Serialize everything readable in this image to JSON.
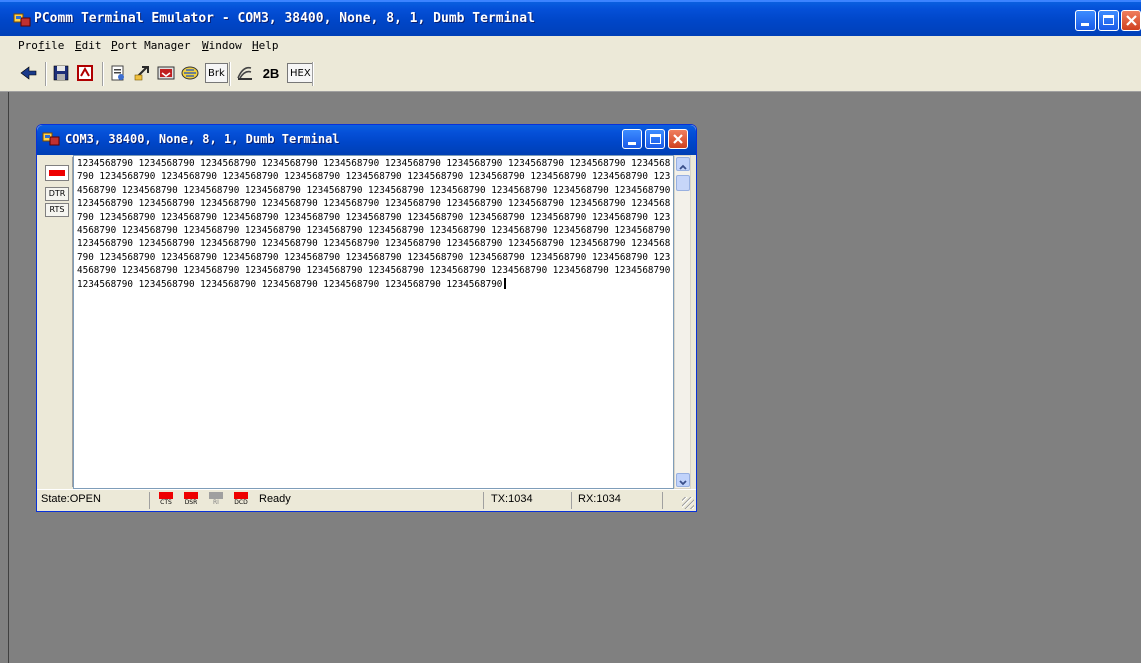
{
  "app": {
    "title": "PComm Terminal Emulator - COM3, 38400, None, 8, 1, Dumb Terminal",
    "colors": {
      "title_bar": "#0046c8",
      "workspace": "#808080",
      "led_on": "#ee0000",
      "led_off": "#a0a0a0"
    }
  },
  "menu": [
    {
      "label": "Profile",
      "key": "f"
    },
    {
      "label": "Edit",
      "key": "E"
    },
    {
      "label": "Port Manager",
      "key": "P"
    },
    {
      "label": "Window",
      "key": "W"
    },
    {
      "label": "Help",
      "key": "H"
    }
  ],
  "toolbar": {
    "brk_label": "Brk",
    "twob_label": "2B",
    "hex_label": "HEX"
  },
  "child": {
    "title": "COM3, 38400, None, 8, 1, Dumb Terminal",
    "dtr_label": "DTR",
    "rts_label": "RTS",
    "terminal_text": "1234568790 1234568790 1234568790 1234568790 1234568790 1234568790 1234568790 1234568790 1234568790 1234568790 1234568790 1234568790 1234568790 1234568790 1234568790 1234568790 1234568790 1234568790 1234568790 1234568790 1234568790 1234568790 1234568790 1234568790 1234568790 1234568790 1234568790 1234568790 1234568790 1234568790 1234568790 1234568790 1234568790 1234568790 1234568790 1234568790 1234568790 1234568790 1234568790 1234568790 1234568790 1234568790 1234568790 1234568790 1234568790 1234568790 1234568790 1234568790 1234568790 1234568790 1234568790 1234568790 1234568790 1234568790 1234568790 1234568790 1234568790 1234568790 1234568790 1234568790 1234568790 1234568790 1234568790 1234568790 1234568790 1234568790 1234568790 1234568790 1234568790 1234568790 1234568790 1234568790 1234568790 1234568790 1234568790 1234568790 1234568790 1234568790 1234568790 1234568790 1234568790 1234568790 1234568790 1234568790 1234568790 1234568790 1234568790 1234568790 1234568790 1234568790 1234568790 1234568790 1234568790 1234568790",
    "status": {
      "state": "State:OPEN",
      "ready": "Ready",
      "tx": "TX:1034",
      "rx": "RX:1034",
      "indicators": [
        {
          "label": "CTS",
          "on": true
        },
        {
          "label": "DSR",
          "on": true
        },
        {
          "label": "RI",
          "on": false
        },
        {
          "label": "DCD",
          "on": true
        }
      ]
    }
  }
}
